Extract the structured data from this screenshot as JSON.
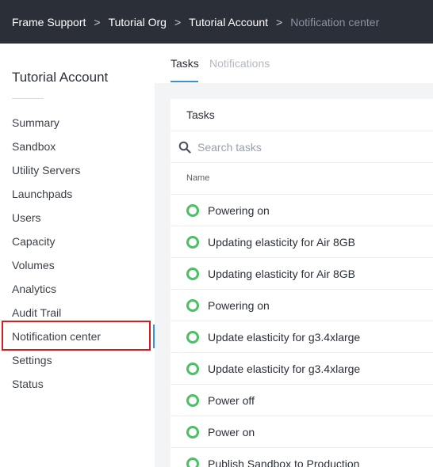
{
  "breadcrumb": [
    "Frame Support",
    "Tutorial Org",
    "Tutorial Account",
    "Notification center"
  ],
  "breadcrumb_separator": ">",
  "sidebar": {
    "title": "Tutorial Account",
    "items": [
      {
        "label": "Summary",
        "name": "summary"
      },
      {
        "label": "Sandbox",
        "name": "sandbox"
      },
      {
        "label": "Utility Servers",
        "name": "utility-servers"
      },
      {
        "label": "Launchpads",
        "name": "launchpads"
      },
      {
        "label": "Users",
        "name": "users"
      },
      {
        "label": "Capacity",
        "name": "capacity"
      },
      {
        "label": "Volumes",
        "name": "volumes"
      },
      {
        "label": "Analytics",
        "name": "analytics"
      },
      {
        "label": "Audit Trail",
        "name": "audit-trail"
      },
      {
        "label": "Notification center",
        "name": "notification-center",
        "active": true
      },
      {
        "label": "Settings",
        "name": "settings"
      },
      {
        "label": "Status",
        "name": "status"
      }
    ]
  },
  "tabs": [
    {
      "label": "Tasks",
      "active": true
    },
    {
      "label": "Notifications",
      "active": false
    }
  ],
  "tasks_panel": {
    "header": "Tasks",
    "search_placeholder": "Search tasks",
    "column_name": "Name",
    "rows": [
      {
        "name": "Powering on",
        "status": "success"
      },
      {
        "name": "Updating elasticity for Air 8GB",
        "status": "success"
      },
      {
        "name": "Updating elasticity for Air 8GB",
        "status": "success"
      },
      {
        "name": "Powering on",
        "status": "success"
      },
      {
        "name": "Update elasticity for g3.4xlarge",
        "status": "success"
      },
      {
        "name": "Update elasticity for g3.4xlarge",
        "status": "success"
      },
      {
        "name": "Power off",
        "status": "success"
      },
      {
        "name": "Power on",
        "status": "success"
      },
      {
        "name": "Publish Sandbox to Production",
        "status": "success"
      }
    ]
  },
  "colors": {
    "topbar_bg": "#2b2f38",
    "accent": "#3d8fd6",
    "success": "#4cc066",
    "highlight": "#d11f1f"
  },
  "icons": {
    "search": "search-icon",
    "task_status": "status-success-icon"
  }
}
